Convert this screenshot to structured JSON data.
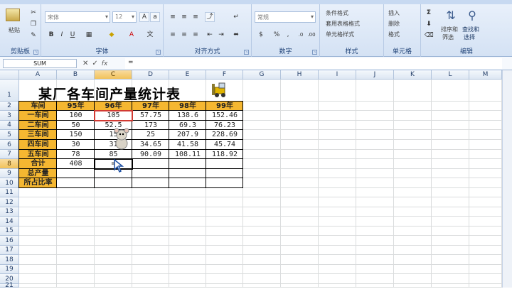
{
  "ribbon": {
    "groups": {
      "clipboard": "剪贴板",
      "font": "字体",
      "alignment": "对齐方式",
      "number": "数字",
      "styles": "样式",
      "cells": "单元格",
      "editing": "编辑"
    },
    "paste_label": "粘贴",
    "font_name": "宋体",
    "font_size": "12",
    "number_format": "常规",
    "styles_items": [
      "条件格式",
      "套用表格格式",
      "单元格样式"
    ],
    "cells_items": [
      "插入",
      "删除",
      "格式"
    ],
    "sort_filter": [
      "排序和",
      "筛选"
    ],
    "find_select": [
      "查找和",
      "选择"
    ]
  },
  "formula_bar": {
    "name_box": "SUM",
    "formula": "="
  },
  "columns": [
    "A",
    "B",
    "C",
    "D",
    "E",
    "F",
    "G",
    "H",
    "I",
    "J",
    "K",
    "L",
    "M"
  ],
  "rows": [
    "1",
    "2",
    "3",
    "4",
    "5",
    "6",
    "7",
    "8",
    "9",
    "10",
    "11",
    "12",
    "13",
    "14",
    "15",
    "16",
    "17",
    "18",
    "19",
    "20",
    "21"
  ],
  "sheet": {
    "title": "某厂各车间产量统计表",
    "header": [
      "车间",
      "95年",
      "96年",
      "97年",
      "98年",
      "99年"
    ],
    "data": [
      [
        "一车间",
        "100",
        "105",
        "57.75",
        "138.6",
        "152.46"
      ],
      [
        "二车间",
        "50",
        "52.5",
        "173",
        "69.3",
        "76.23"
      ],
      [
        "三车间",
        "150",
        "15",
        "25",
        "207.9",
        "228.69"
      ],
      [
        "四车间",
        "30",
        "31",
        "34.65",
        "41.58",
        "45.74"
      ],
      [
        "五车间",
        "78",
        "85",
        "90.09",
        "108.11",
        "118.92"
      ]
    ],
    "total_row": [
      "合计",
      "408",
      "="
    ],
    "labels_below": [
      "总产量",
      "所占比率"
    ]
  },
  "colors": {
    "header_fill": "#f5b731",
    "label_fill": "#f5b731",
    "selection": "#d13a33"
  }
}
